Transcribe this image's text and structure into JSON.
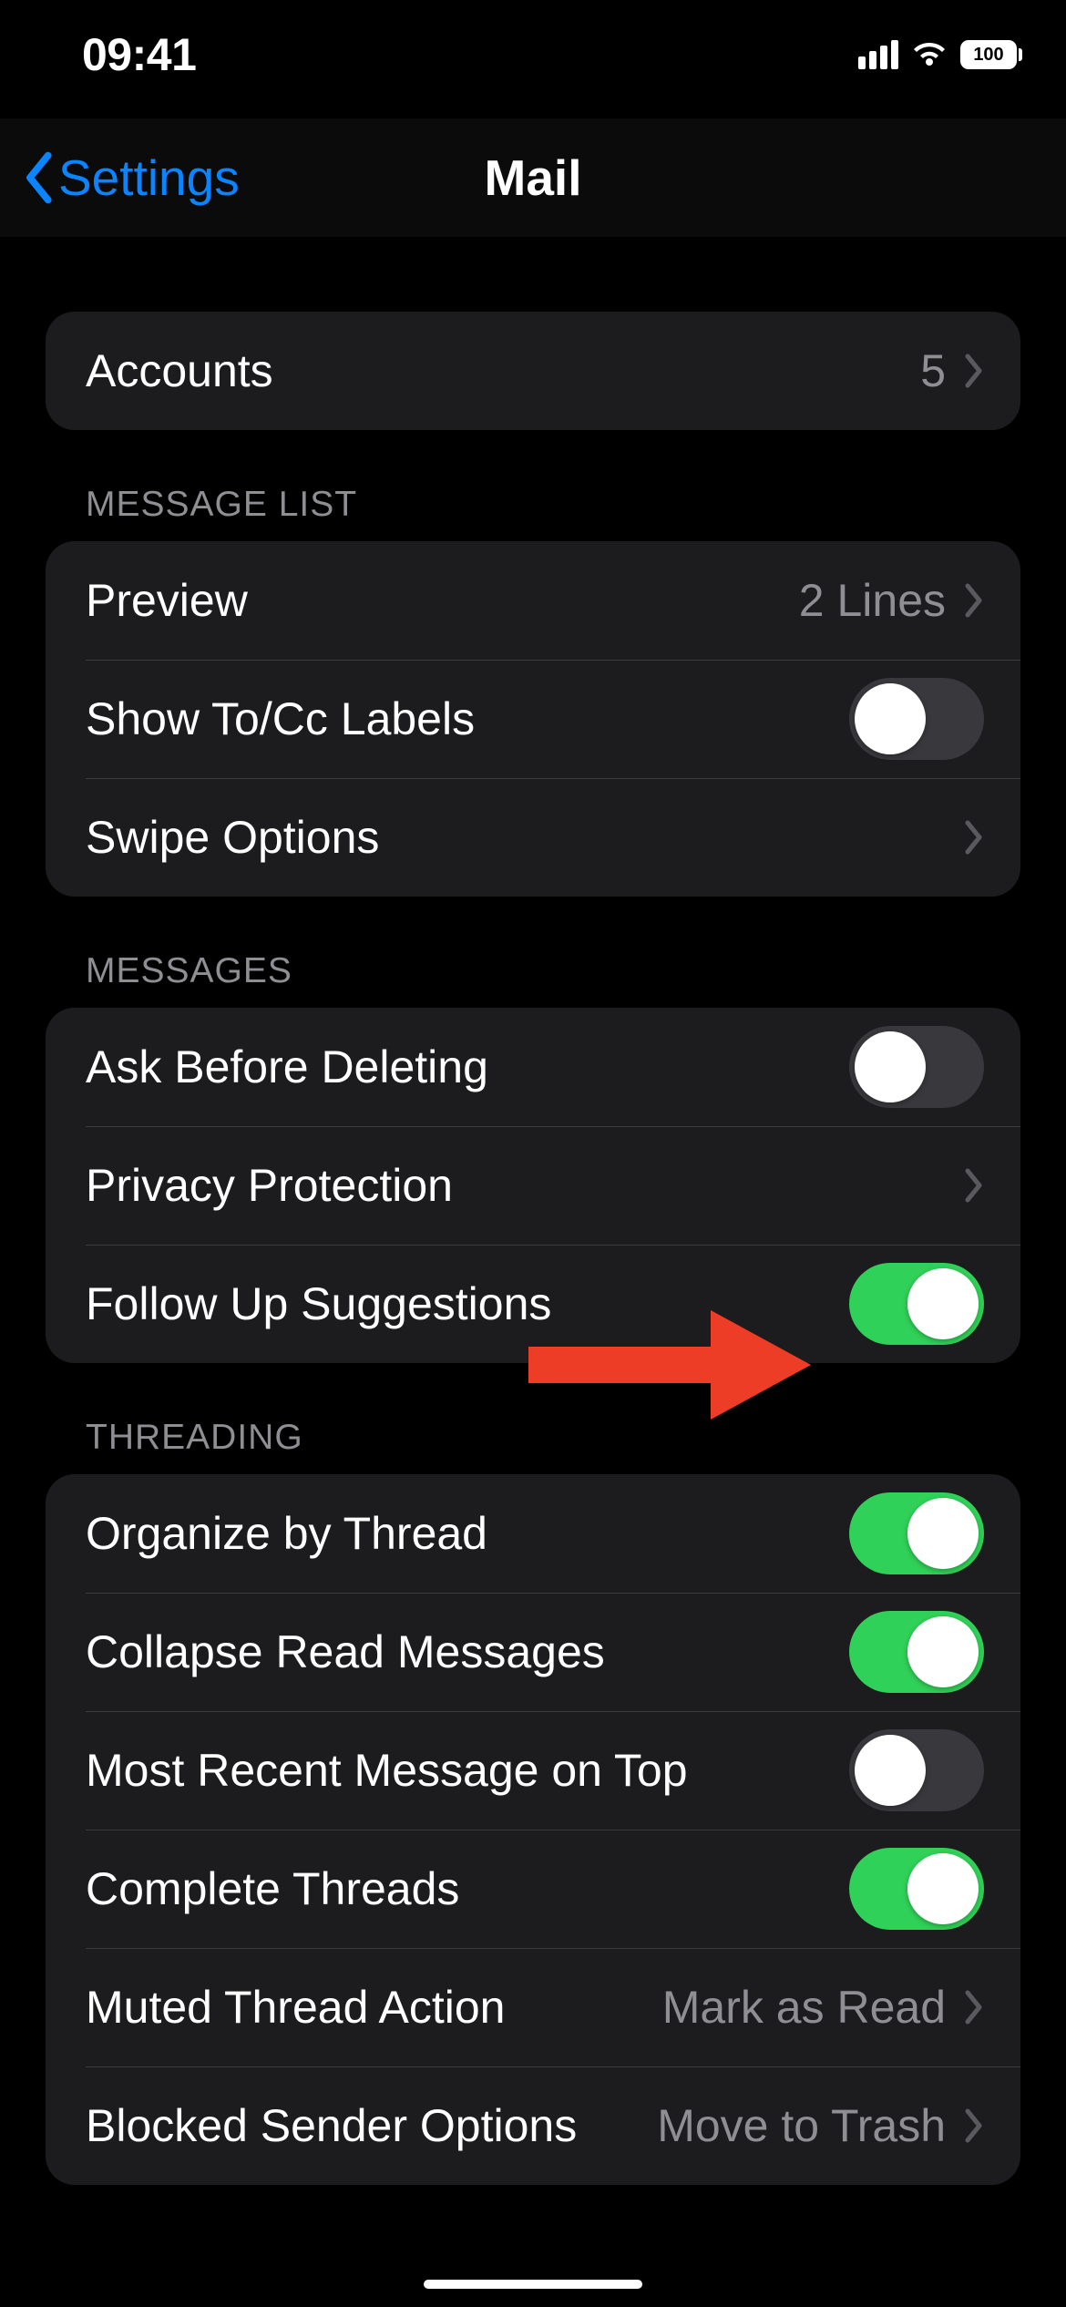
{
  "status": {
    "time": "09:41",
    "battery": "100"
  },
  "nav": {
    "back": "Settings",
    "title": "Mail"
  },
  "groups": {
    "accounts": {
      "row_accounts": {
        "label": "Accounts",
        "value": "5"
      }
    },
    "message_list": {
      "header": "MESSAGE LIST",
      "row_preview": {
        "label": "Preview",
        "value": "2 Lines"
      },
      "row_show_tocc": {
        "label": "Show To/Cc Labels"
      },
      "row_swipe": {
        "label": "Swipe Options"
      }
    },
    "messages": {
      "header": "MESSAGES",
      "row_ask_delete": {
        "label": "Ask Before Deleting"
      },
      "row_privacy": {
        "label": "Privacy Protection"
      },
      "row_followup": {
        "label": "Follow Up Suggestions"
      }
    },
    "threading": {
      "header": "THREADING",
      "row_organize": {
        "label": "Organize by Thread"
      },
      "row_collapse": {
        "label": "Collapse Read Messages"
      },
      "row_recent_top": {
        "label": "Most Recent Message on Top"
      },
      "row_complete": {
        "label": "Complete Threads"
      },
      "row_muted": {
        "label": "Muted Thread Action",
        "value": "Mark as Read"
      },
      "row_blocked": {
        "label": "Blocked Sender Options",
        "value": "Move to Trash"
      }
    }
  },
  "toggles": {
    "show_tocc": false,
    "ask_delete": false,
    "followup": true,
    "organize": true,
    "collapse": true,
    "recent_top": false,
    "complete": true
  }
}
